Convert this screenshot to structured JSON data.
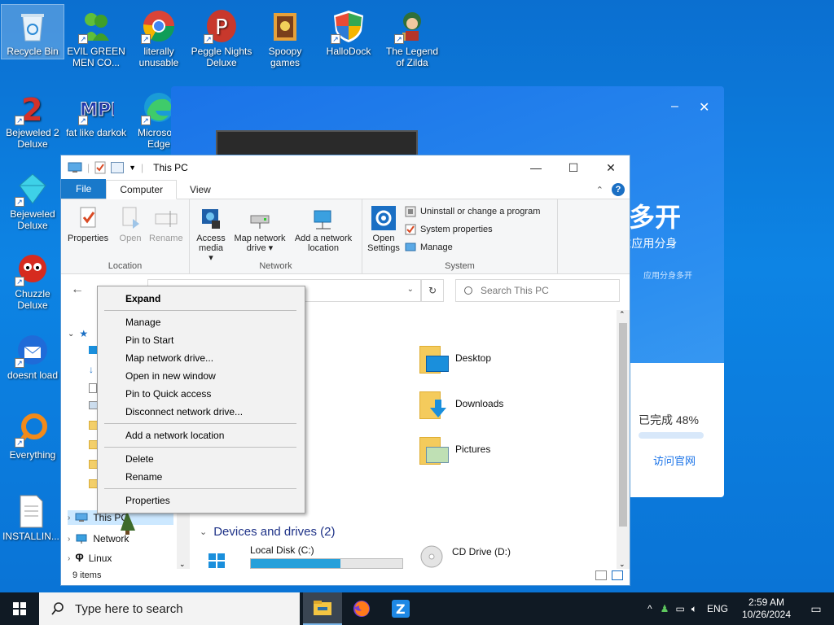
{
  "desktop_icons": [
    {
      "label": "Recycle Bin"
    },
    {
      "label": "EVIL GREEN MEN CO..."
    },
    {
      "label": "literally unusable"
    },
    {
      "label": "Peggle Nights Deluxe"
    },
    {
      "label": "Spoopy games"
    },
    {
      "label": "HalloDock"
    },
    {
      "label": "The Legend of Zilda"
    },
    {
      "label": "Bejeweled 2 Deluxe"
    },
    {
      "label": "fat like darkok"
    },
    {
      "label": "Microso... Edge"
    },
    {
      "label": "Bejeweled Deluxe"
    },
    {
      "label": "Chuzzle Deluxe"
    },
    {
      "label": "doesnt load"
    },
    {
      "label": "Everything"
    },
    {
      "label": "INSTALLIN..."
    }
  ],
  "bg_app": {
    "big_text": "多开",
    "sub_text": "E应用分身",
    "tiny_text": "应用分身多开",
    "progress_text": "已完成 48%",
    "link_text": "访问官网",
    "minimize": "–",
    "close": "✕"
  },
  "explorer": {
    "title": "This PC",
    "tabs": {
      "file": "File",
      "computer": "Computer",
      "view": "View"
    },
    "help": "?",
    "ribbon": {
      "location": {
        "name": "Location",
        "properties": "Properties",
        "open": "Open",
        "rename": "Rename"
      },
      "network": {
        "name": "Network",
        "access_media": "Access media",
        "map_drive": "Map network drive",
        "add_location": "Add a network location"
      },
      "system": {
        "name": "System",
        "open_settings": "Open Settings",
        "uninstall": "Uninstall or change a program",
        "sys_props": "System properties",
        "manage": "Manage"
      }
    },
    "search_placeholder": "Search This PC",
    "folders": [
      "Desktop",
      "Downloads",
      "Pictures"
    ],
    "devices_header": "Devices and drives (2)",
    "drives": [
      {
        "name": "Local Disk (C:)",
        "used_fraction": 0.59
      },
      {
        "name": "CD Drive (D:)"
      }
    ],
    "nav": {
      "this_pc": "This PC",
      "network": "Network",
      "linux": "Linux"
    },
    "status": "9 items"
  },
  "context_menu": {
    "expand": "Expand",
    "manage": "Manage",
    "pin_start": "Pin to Start",
    "map_drive": "Map network drive...",
    "open_new": "Open in new window",
    "pin_quick": "Pin to Quick access",
    "disconnect": "Disconnect network drive...",
    "add_location": "Add a network location",
    "delete": "Delete",
    "rename": "Rename",
    "properties": "Properties"
  },
  "taskbar": {
    "search_placeholder": "Type here to search",
    "lang": "ENG",
    "time": "2:59 AM",
    "date": "10/26/2024"
  },
  "colors": {
    "accent": "#1979ca",
    "desktop": "#0b78d8",
    "taskbar": "#101a24",
    "drive_bar": "#26a0da"
  }
}
